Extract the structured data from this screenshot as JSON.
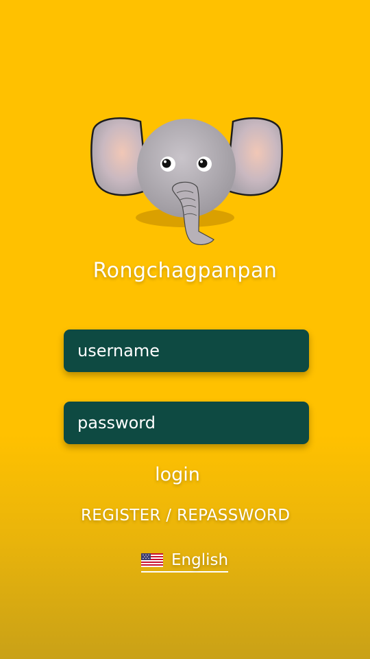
{
  "app": {
    "name": "Rongchagpanpan"
  },
  "login_form": {
    "username_placeholder": "username",
    "password_placeholder": "password",
    "login_label": "login",
    "register_label": "REGISTER / REPASSWORD"
  },
  "language": {
    "label": "English",
    "flag_icon": "us-flag-icon"
  },
  "colors": {
    "background": "#FFC100",
    "field_background": "#0E4A42",
    "text": "#FFFFFF"
  },
  "logo": {
    "icon": "elephant-icon"
  }
}
